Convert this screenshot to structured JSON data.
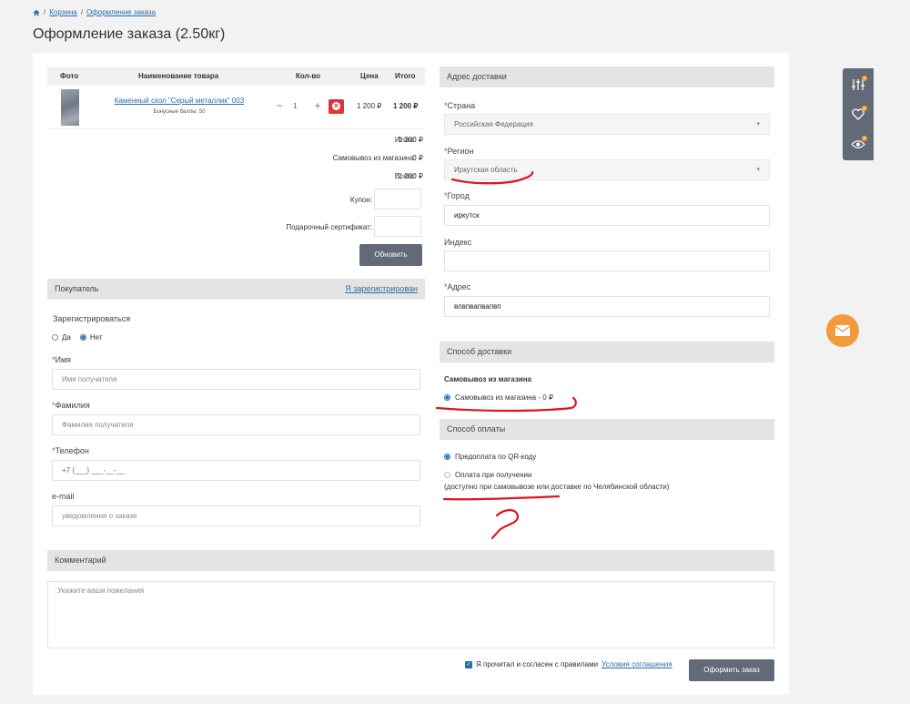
{
  "breadcrumb": {
    "home_icon": "home-icon",
    "items": [
      "Корзина",
      "Оформление заказа"
    ]
  },
  "page_title": "Оформление заказа (2.50кг)",
  "cart_table": {
    "headers": [
      "Фото",
      "Наименование товара",
      "Кол-во",
      "Цена",
      "Итого"
    ],
    "rows": [
      {
        "name": "Каменный скол \"Серый металлик\" 003",
        "bonus": "Бонусные баллы: 50",
        "qty": "1",
        "price": "1 200 ₽",
        "total": "1 200 ₽"
      }
    ]
  },
  "summary": [
    {
      "label": "Итого:",
      "value": "1 200 ₽"
    },
    {
      "label": "Самовывоз из магазина:",
      "value": "0 ₽"
    },
    {
      "label": "Всего:",
      "value": "1 200 ₽"
    }
  ],
  "coupon": {
    "label": "Купон:"
  },
  "gift": {
    "label": "Подарочный сертификат:"
  },
  "update_button": "Обновить",
  "buyer": {
    "section_title": "Покупатель",
    "registered_link": "Я зарегистрирован",
    "register_label": "Зарегистрироваться",
    "register_options": [
      "Да",
      "Нет"
    ],
    "register_selected": "Нет",
    "name_label": "Имя",
    "name_placeholder": "Имя получателя",
    "surname_label": "Фамилия",
    "surname_placeholder": "Фамилия получателя",
    "phone_label": "Телефон",
    "phone_value": "+7 (___) ___-__-__",
    "email_label": "e-mail",
    "email_placeholder": "уведомления о заказе",
    "required_mark": "*"
  },
  "address": {
    "section_title": "Адрес доставки",
    "country_label": "Страна",
    "country_value": "Российская Федерация",
    "region_label": "Регион",
    "region_value": "Иркутская область",
    "city_label": "Город",
    "city_value": "иркутск",
    "index_label": "Индекс",
    "index_value": "",
    "addr_label": "Адрес",
    "addr_value": "впвпвапвапвп"
  },
  "delivery": {
    "section_title": "Способ доставки",
    "group_title": "Самовывоз из магазина",
    "option": "Самовывоз из магазина - 0 ₽"
  },
  "payment": {
    "section_title": "Способ оплаты",
    "options": [
      "Предоплата по QR-коду",
      "Оплата при получении"
    ],
    "note": "(доступно при самовывозе или доставке по Челябинской области)"
  },
  "comment": {
    "section_title": "Комментарий",
    "placeholder": "Укажите ваши пожелания"
  },
  "agreement": {
    "text": "Я прочитал и согласен с правилами",
    "link": "Условия соглашения"
  },
  "submit_button": "Оформить заказ",
  "side_toolbar": {
    "items": [
      {
        "icon": "compare-sliders-icon",
        "count": "0"
      },
      {
        "icon": "heart-icon",
        "count": "0"
      },
      {
        "icon": "eye-icon",
        "count": "6"
      }
    ]
  },
  "colors": {
    "accent_red": "#d9363e",
    "button_dark": "#626a78",
    "mail_orange": "#f39a3a",
    "link_blue": "#2a6ea8"
  }
}
